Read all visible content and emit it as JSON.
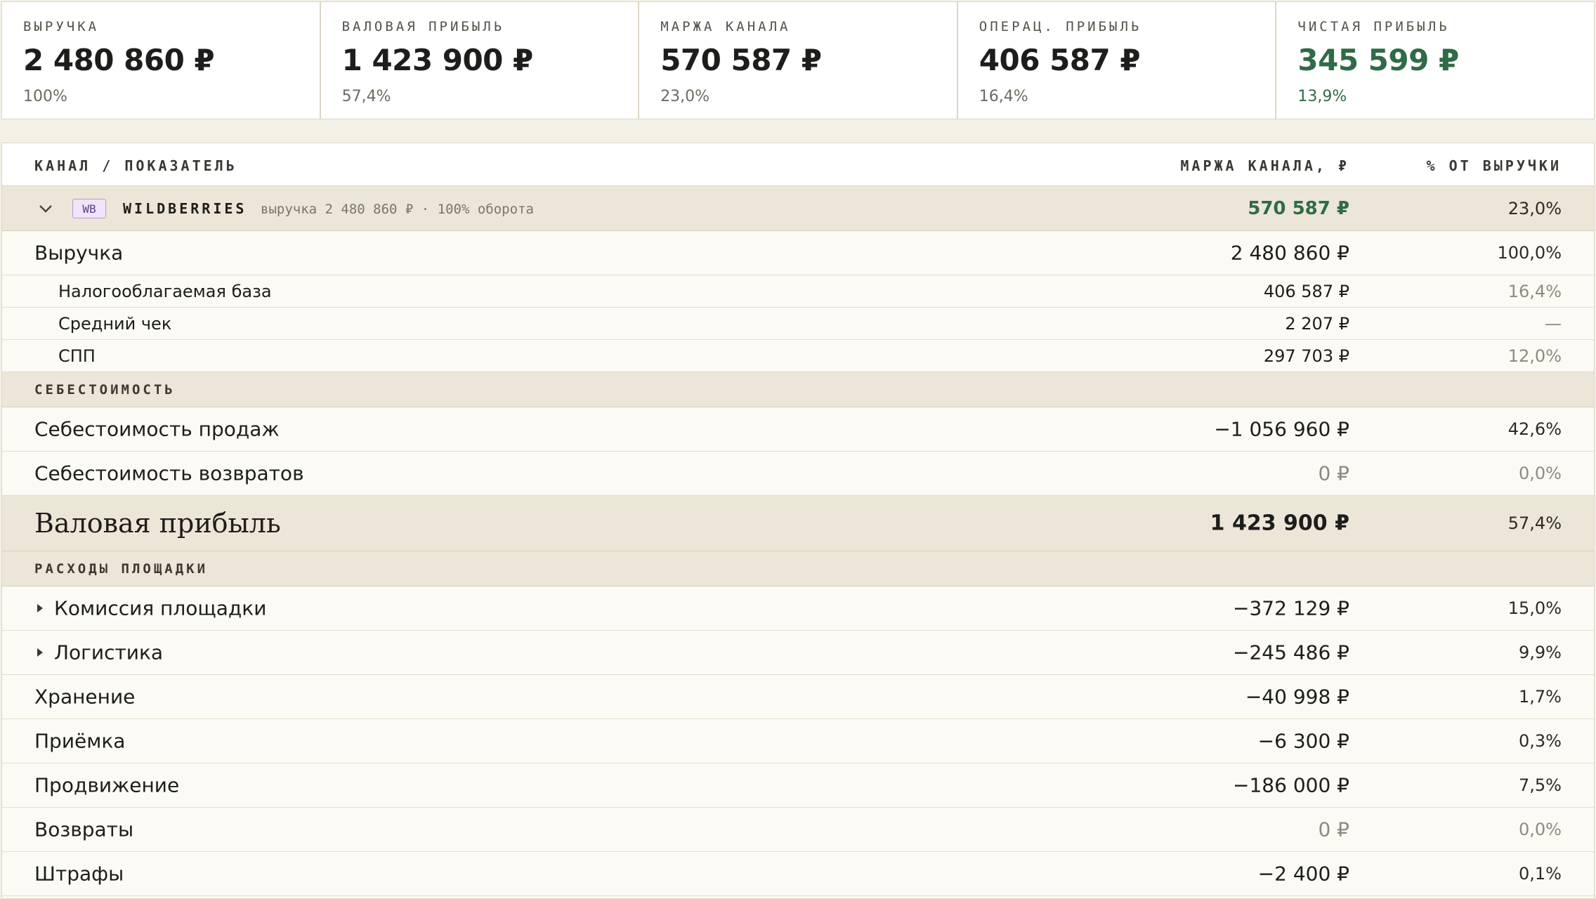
{
  "kpis": [
    {
      "label": "ВЫРУЧКА",
      "value": "2 480 860 ₽",
      "pct": "100%"
    },
    {
      "label": "ВАЛОВАЯ ПРИБЫЛЬ",
      "value": "1 423 900 ₽",
      "pct": "57,4%"
    },
    {
      "label": "МАРЖА КАНАЛА",
      "value": "570 587 ₽",
      "pct": "23,0%"
    },
    {
      "label": "ОПЕРАЦ. ПРИБЫЛЬ",
      "value": "406 587 ₽",
      "pct": "16,4%"
    },
    {
      "label": "ЧИСТАЯ ПРИБЫЛЬ",
      "value": "345 599 ₽",
      "pct": "13,9%"
    }
  ],
  "table": {
    "headers": {
      "left": "КАНАЛ / ПОКАЗАТЕЛЬ",
      "mid": "МАРЖА КАНАЛА, ₽",
      "right": "% ОТ ВЫРУЧКИ"
    },
    "channel": {
      "badge": "WB",
      "name": "WILDBERRIES",
      "sub": "выручка 2 480 860 ₽ · 100% оборота",
      "value": "570 587 ₽",
      "pct": "23,0%"
    },
    "revenue": {
      "label": "Выручка",
      "value": "2 480 860 ₽",
      "pct": "100,0%"
    },
    "sub_rows": [
      {
        "label": "Налогооблагаемая база",
        "value": "406 587 ₽",
        "pct": "16,4%"
      },
      {
        "label": "Средний чек",
        "value": "2 207 ₽",
        "pct": "—"
      },
      {
        "label": "СПП",
        "value": "297 703 ₽",
        "pct": "12,0%"
      }
    ],
    "section_cost": "СЕБЕСТОИМОСТЬ",
    "cost_rows": [
      {
        "label": "Себестоимость продаж",
        "value": "−1 056 960 ₽",
        "pct": "42,6%"
      },
      {
        "label": "Себестоимость возвратов",
        "value": "0 ₽",
        "pct": "0,0%"
      }
    ],
    "gross": {
      "label": "Валовая прибыль",
      "value": "1 423 900 ₽",
      "pct": "57,4%"
    },
    "section_market": "РАСХОДЫ ПЛОЩАДКИ",
    "market_rows": [
      {
        "label": "Комиссия площадки",
        "value": "−372 129 ₽",
        "pct": "15,0%"
      },
      {
        "label": "Логистика",
        "value": "−245 486 ₽",
        "pct": "9,9%"
      },
      {
        "label": "Хранение",
        "value": "−40 998 ₽",
        "pct": "1,7%"
      },
      {
        "label": "Приёмка",
        "value": "−6 300 ₽",
        "pct": "0,3%"
      },
      {
        "label": "Продвижение",
        "value": "−186 000 ₽",
        "pct": "7,5%"
      },
      {
        "label": "Возвраты",
        "value": "0 ₽",
        "pct": "0,0%"
      },
      {
        "label": "Штрафы",
        "value": "−2 400 ₽",
        "pct": "0,1%"
      }
    ]
  },
  "colors": {
    "accent_green": "#2f6b46",
    "section_bg": "#ece6d8",
    "badge_purple": "#b49bd6"
  }
}
